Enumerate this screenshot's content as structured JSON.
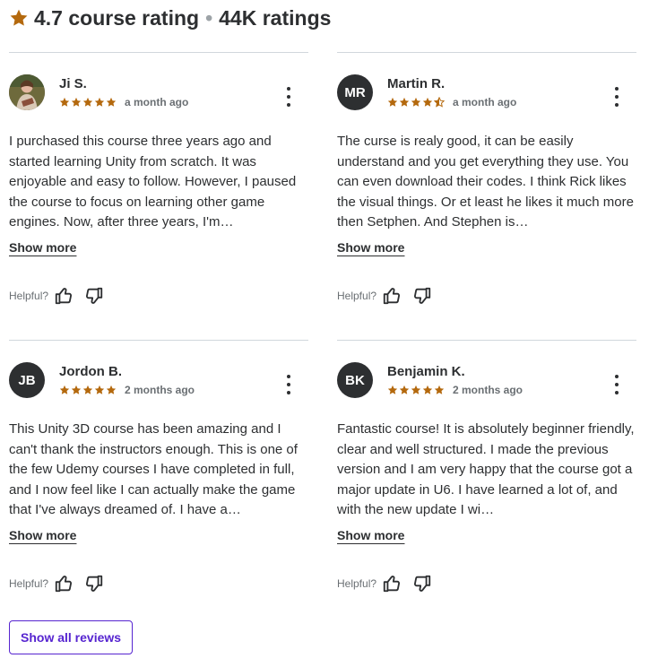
{
  "header": {
    "rating": "4.7 course rating",
    "separator": "•",
    "count": "44K ratings",
    "star_color": "#b4690e",
    "star_icon": "star-icon"
  },
  "reviews": [
    {
      "initials": "",
      "avatar": "photo",
      "name": "Ji S.",
      "rating": 5,
      "time": "a month ago",
      "text": "I purchased this course three years ago and started learning Unity from scratch. It was enjoyable and easy to follow. However, I paused the course to focus on learning other game engines. Now, after three years, I'm…",
      "show_more": "Show more",
      "helpful": "Helpful?"
    },
    {
      "initials": "MR",
      "name": "Martin R.",
      "rating": 4.5,
      "time": "a month ago",
      "text": "The curse is realy good, it can be easily understand and you get everything they use. You can even download their codes. I think Rick likes the visual things. Or et least he likes it much more then Setphen. And Stephen is…",
      "show_more": "Show more",
      "helpful": "Helpful?"
    },
    {
      "initials": "JB",
      "name": "Jordon B.",
      "rating": 5,
      "time": "2 months ago",
      "text": "This Unity 3D course has been amazing and I can't thank the instructors enough. This is one of the few Udemy courses I have completed in full, and I now feel like I can actually make the game that I've always dreamed of. I have a…",
      "show_more": "Show more",
      "helpful": "Helpful?"
    },
    {
      "initials": "BK",
      "name": "Benjamin K.",
      "rating": 5,
      "time": "2 months ago",
      "text": "Fantastic course! It is absolutely beginner friendly, clear and well structured. I made the previous version and I am very happy that the course got a major update in U6. I have learned a lot of, and with the new update I wi…",
      "show_more": "Show more",
      "helpful": "Helpful?"
    }
  ],
  "footer": {
    "show_all": "Show all reviews",
    "accent": "#5624d0"
  },
  "icons": [
    "star-icon",
    "star-half-icon",
    "more-vertical-icon",
    "thumbs-up-icon",
    "thumbs-down-icon"
  ]
}
